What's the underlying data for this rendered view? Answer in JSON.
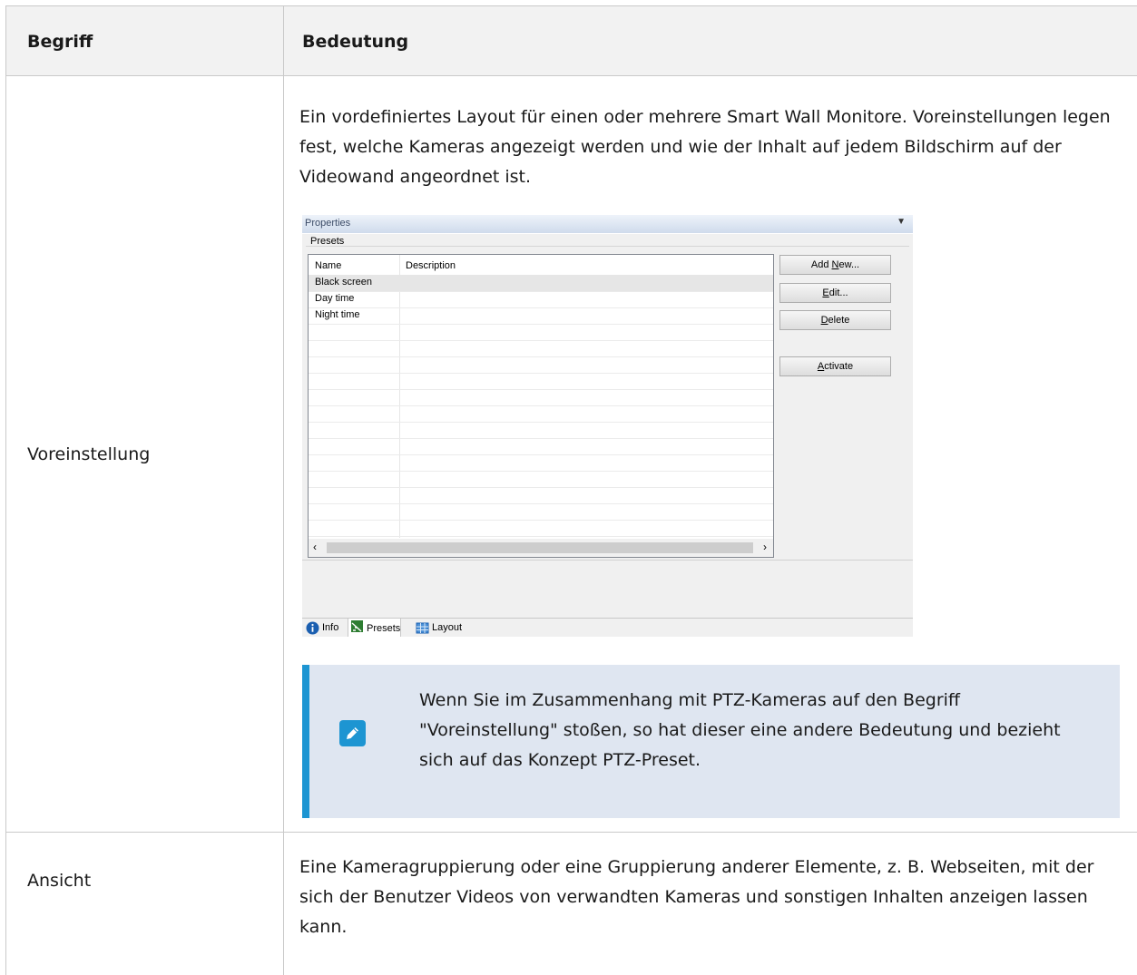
{
  "table": {
    "header": {
      "col1": "Begriff",
      "col2": "Bedeutung"
    },
    "rows": [
      {
        "term": "Voreinstellung",
        "meaning": "Ein vordefiniertes Layout für einen oder mehrere Smart Wall Monitore. Voreinstellungen legen fest, welche Kameras angezeigt werden und wie der Inhalt auf jedem Bildschirm auf der Videowand angeordnet ist.",
        "note": "Wenn Sie im Zusammenhang mit PTZ-Kameras auf den Begriff \"Voreinstellung\" stoßen, so hat dieser eine andere Bedeutung und bezieht sich auf das Konzept PTZ-Preset."
      },
      {
        "term": "Ansicht",
        "meaning": "Eine Kameragruppierung oder eine Gruppierung anderer Elemente, z. B. Webseiten, mit der sich der Benutzer Videos von verwandten Kameras und sonstigen Inhalten anzeigen lassen kann."
      }
    ]
  },
  "properties_panel": {
    "title": "Properties",
    "group": "Presets",
    "columns": [
      "Name",
      "Description"
    ],
    "presets": [
      "Black screen",
      "Day time",
      "Night time"
    ],
    "buttons": {
      "add_new": {
        "before": "Add ",
        "mnemonic": "N",
        "after": "ew..."
      },
      "edit": {
        "before": "",
        "mnemonic": "E",
        "after": "dit..."
      },
      "delete": {
        "before": "",
        "mnemonic": "D",
        "after": "elete"
      },
      "activate": {
        "before": "",
        "mnemonic": "A",
        "after": "ctivate"
      }
    },
    "tabs": [
      "Info",
      "Presets",
      "Layout"
    ]
  },
  "colors": {
    "accent": "#1d95d2",
    "note_bg": "#dfe6f1",
    "header_bg": "#f2f2f2"
  }
}
